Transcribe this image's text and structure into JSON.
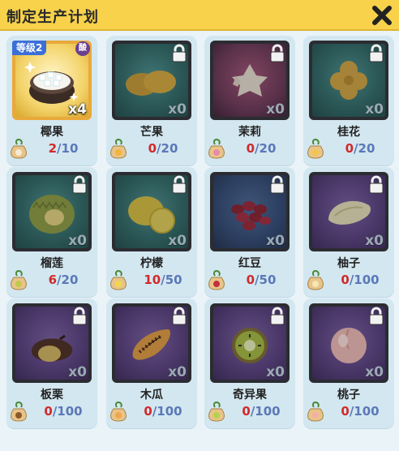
{
  "header": {
    "title": "制定生产计划"
  },
  "colors": {
    "header_bg": "#f7d24a",
    "current": "#d02a2a",
    "max": "#5a78b8"
  },
  "items": [
    {
      "name": "椰果",
      "current": "2",
      "max": "10",
      "qty": "x4",
      "level": "等级2",
      "badge": "酸",
      "unlocked": true,
      "bg": "gold"
    },
    {
      "name": "芒果",
      "current": "0",
      "max": "20",
      "qty": "x0",
      "unlocked": false,
      "bg": "teal"
    },
    {
      "name": "茉莉",
      "current": "0",
      "max": "20",
      "qty": "x0",
      "unlocked": false,
      "bg": "teal"
    },
    {
      "name": "桂花",
      "current": "0",
      "max": "20",
      "qty": "x0",
      "unlocked": false,
      "bg": "teal"
    },
    {
      "name": "榴莲",
      "current": "6",
      "max": "20",
      "qty": "x0",
      "unlocked": false,
      "bg": "teal"
    },
    {
      "name": "柠檬",
      "current": "10",
      "max": "50",
      "qty": "x0",
      "unlocked": false,
      "bg": "teal"
    },
    {
      "name": "红豆",
      "current": "0",
      "max": "50",
      "qty": "x0",
      "unlocked": false,
      "bg": "teal"
    },
    {
      "name": "柚子",
      "current": "0",
      "max": "100",
      "qty": "x0",
      "unlocked": false,
      "bg": "purple"
    },
    {
      "name": "板栗",
      "current": "0",
      "max": "100",
      "qty": "x0",
      "unlocked": false,
      "bg": "purple"
    },
    {
      "name": "木瓜",
      "current": "0",
      "max": "100",
      "qty": "x0",
      "unlocked": false,
      "bg": "purple"
    },
    {
      "name": "奇异果",
      "current": "0",
      "max": "100",
      "qty": "x0",
      "unlocked": false,
      "bg": "purple"
    },
    {
      "name": "桃子",
      "current": "0",
      "max": "100",
      "qty": "x0",
      "unlocked": false,
      "bg": "purple"
    }
  ]
}
